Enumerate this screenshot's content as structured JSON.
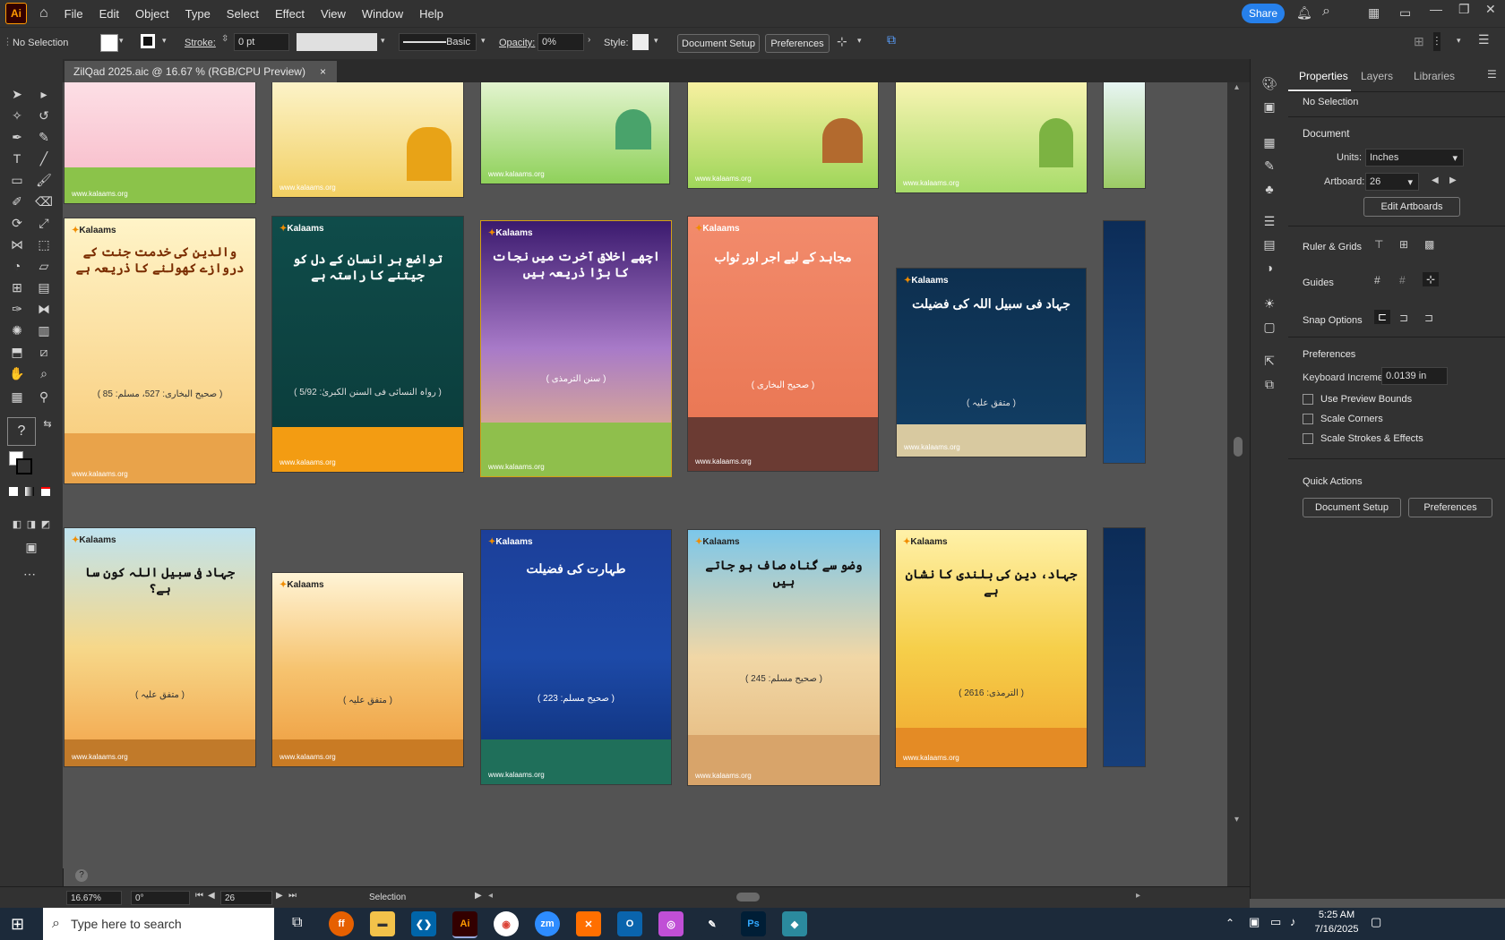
{
  "menubar": {
    "logo": "Ai",
    "items": [
      "File",
      "Edit",
      "Object",
      "Type",
      "Select",
      "Effect",
      "View",
      "Window",
      "Help"
    ],
    "share_label": "Share"
  },
  "controlbar": {
    "selection": "No Selection",
    "stroke_label": "Stroke:",
    "stroke_value": "0 pt",
    "brush_label": "Basic",
    "opacity_label": "Opacity:",
    "opacity_value": "0%",
    "style_label": "Style:",
    "document_setup": "Document Setup",
    "preferences": "Preferences"
  },
  "document_tab": {
    "title": "ZilQad 2025.aic @ 16.67 % (RGB/CPU Preview)",
    "close": "×"
  },
  "properties": {
    "tabs": [
      "Properties",
      "Layers",
      "Libraries"
    ],
    "no_selection": "No Selection",
    "document_heading": "Document",
    "units_label": "Units:",
    "units_value": "Inches",
    "artboard_label": "Artboard:",
    "artboard_value": "26",
    "edit_artboards": "Edit Artboards",
    "ruler_grids": "Ruler & Grids",
    "guides": "Guides",
    "snap_options": "Snap Options",
    "preferences_heading": "Preferences",
    "keyboard_increment_label": "Keyboard Increment:",
    "keyboard_increment_value": "0.0139 in",
    "checkboxes": [
      "Use Preview Bounds",
      "Scale Corners",
      "Scale Strokes & Effects"
    ],
    "quick_actions": "Quick Actions",
    "document_setup_btn": "Document Setup",
    "preferences_btn": "Preferences"
  },
  "statusbar": {
    "zoom": "16.67%",
    "rotation": "0°",
    "artboard_num": "26",
    "tool_name": "Selection"
  },
  "taskbar": {
    "search_placeholder": "Type here to search",
    "time": "5:25 AM",
    "date": "7/16/2025"
  },
  "artboards": {
    "brand": "Kalaams",
    "website": "www.kalaams.org",
    "row2": [
      {
        "title": "والدین کی خدمت جنت کے دروازے کھولنے کا ذریعہ ہے",
        "ref": "( صحیح البخاری: 527، مسلم: 85 )"
      },
      {
        "title": "تواضع ہر انسان کے دل کو جیتنے کا راستہ ہے",
        "ref": "( رواہ النسائی فی السنن الکبریٰ: 5/92 )"
      },
      {
        "title": "اچھے اخلاق آخرت میں نجات کا بڑا ذریعہ ہیں",
        "ref": "( سنن الترمذی )"
      },
      {
        "title": "مجاہد کے لیے اجر اور ثواب",
        "ref": "( صحیح البخاری )"
      },
      {
        "title": "جہاد فی سبیل اللہ کی فضیلت",
        "ref": "( متفق علیہ )"
      }
    ],
    "row3": [
      {
        "title": "جہاد فی سبیل اللہ کون سا ہے؟",
        "ref": "( متفق علیہ )"
      },
      {
        "title": "",
        "ref": "( متفق علیہ )"
      },
      {
        "title": "طہارت کی فضیلت",
        "ref": "( صحیح مسلم: 223 )"
      },
      {
        "title": "وضو سے گناہ صاف ہو جاتے ہیں",
        "ref": "( صحیح مسلم: 245 )"
      },
      {
        "title": "جہاد، دین کی بلندی کا نشان ہے",
        "ref": "( الترمذی: 2616 )"
      }
    ]
  },
  "colors": {
    "accent_blue": "#2680eb",
    "panel": "#323232",
    "canvas": "#535353"
  }
}
